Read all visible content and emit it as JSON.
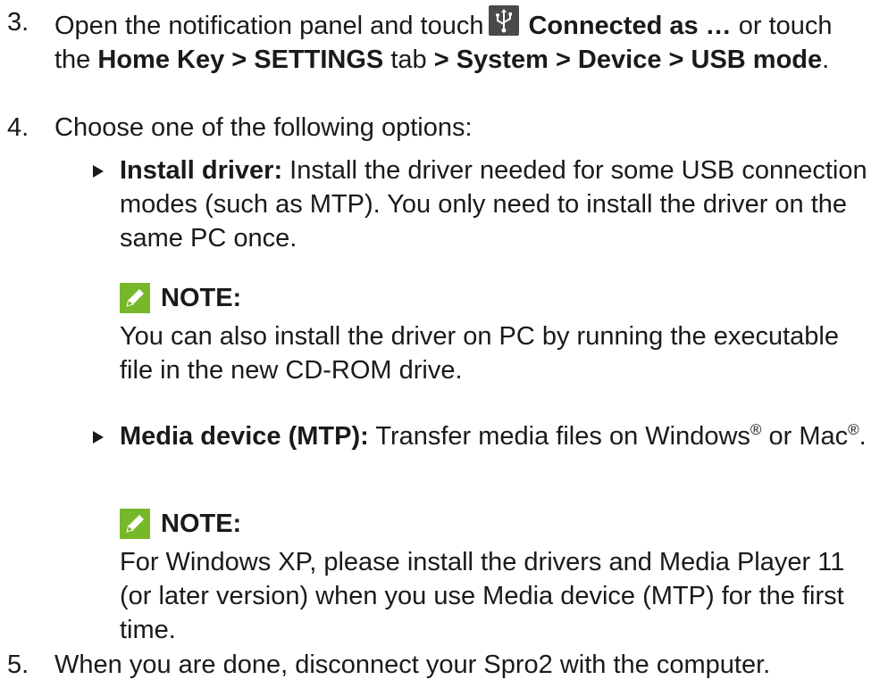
{
  "step3": {
    "number": "3.",
    "text1": "Open the notification panel and touch",
    "icon": "usb-icon",
    "bold1": "Connected as …",
    "text2": " or touch the ",
    "bold2": "Home Key > SETTINGS",
    "text3": " tab ",
    "bold3": "> System > Device > USB mode",
    "text4": "."
  },
  "step4": {
    "number": "4.",
    "text": "Choose one of the following options:"
  },
  "option1": {
    "bold": "Install driver:",
    "text": " Install the driver needed for some USB connection modes (such as MTP). You only need to install the driver on the same PC once."
  },
  "note1": {
    "label": "NOTE:",
    "text": "You can also install the driver on PC by running the executable file in the new CD-ROM drive."
  },
  "option2": {
    "bold": "Media device (MTP):",
    "text1": " Transfer media files on Windows",
    "reg1": "®",
    "text2": " or Mac",
    "reg2": "®",
    "text3": "."
  },
  "note2": {
    "label": "NOTE:",
    "text": "For Windows XP, please install the drivers and Media Player 11 (or later version) when you use Media device (MTP) for the first time."
  },
  "step5": {
    "number": "5.",
    "text": "When you are done, disconnect your Spro2 with the computer."
  },
  "colors": {
    "text": "#1a1a1a",
    "note_icon": "#76b82a",
    "usb_icon_bg": "#4a4a4a"
  }
}
